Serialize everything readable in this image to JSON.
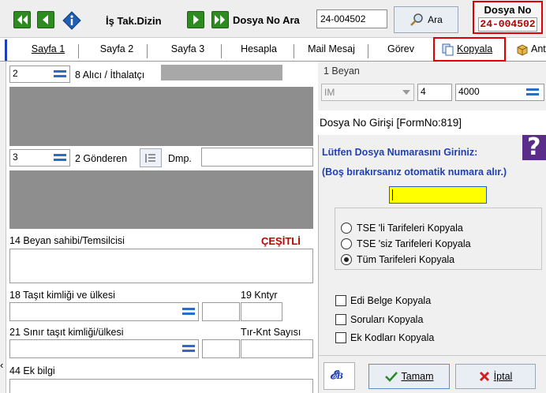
{
  "toolbar": {
    "dizin_label": "İş Tak.Dizin",
    "dosya_ara_label": "Dosya No Ara",
    "search_value": "24-004502",
    "ara_button": "Ara",
    "dosya_no_title": "Dosya No",
    "dosya_no_value": "24-004502"
  },
  "tabs": [
    "Sayfa 1",
    "Sayfa 2",
    "Sayfa 3",
    "Hesapla",
    "Mail Mesaj",
    "Görev",
    "Kopyala",
    "Ant"
  ],
  "left": {
    "alici_value": "2",
    "alici_label": "8 Alıcı / İthalatçı",
    "gonderen_value": "3",
    "gonderen_label": "2 Gönderen",
    "dmp_label": "Dmp.",
    "beyan_label": "14 Beyan sahibi/Temsilcisi",
    "cesitli": "ÇEŞİTLİ",
    "tasit_label": "18 Taşıt kimliği ve ülkesi",
    "kntyr_label": "19 Kntyr",
    "sinir_label": "21 Sınır taşıt kimliği/ülkesi",
    "tir_label": "Tır-Knt Sayısı",
    "ek_bilgi_label": "44 Ek bilgi"
  },
  "right": {
    "beyan_label": "1 Beyan",
    "im_value": "IM",
    "num4": "4",
    "num4000": "4000"
  },
  "dialog": {
    "title": "Dosya No Girişi [FormNo:819]",
    "prompt": "Lütfen Dosya Numarasını Giriniz:",
    "note": "(Boş bırakırsanız otomatik numara alır.)",
    "radio_options": [
      "TSE 'li Tarifeleri Kopyala",
      "TSE 'siz Tarifeleri Kopyala",
      "Tüm Tarifeleri Kopyala"
    ],
    "selected_radio": "Tüm Tarifeleri Kopyala",
    "checkboxes": [
      "Edi Belge Kopyala",
      "Soruları Kopyala",
      "Ek Kodları Kopyala"
    ],
    "ok_label": "Tamam",
    "cancel_label": "İptal"
  },
  "colors": {
    "accent_green": "#2e8b1f",
    "highlight_red": "#e00000",
    "dialog_blue_text": "#1f3fb4",
    "input_yellow": "#ffff00",
    "cesitli_red": "#c00000"
  }
}
